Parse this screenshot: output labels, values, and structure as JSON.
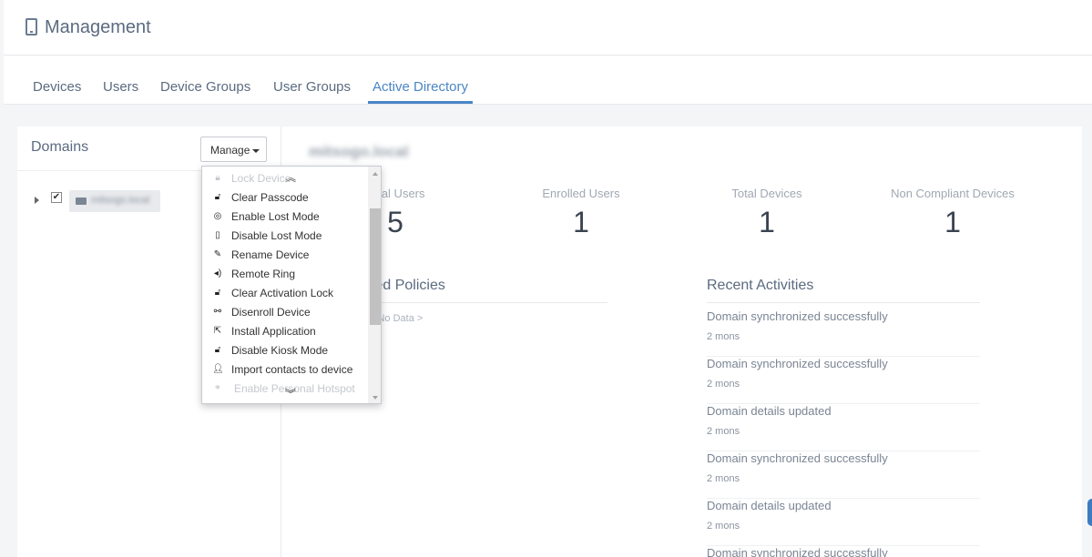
{
  "header": {
    "title": "Management",
    "icon": "mobile-phone-icon"
  },
  "tabs": [
    {
      "label": "Devices",
      "active": false
    },
    {
      "label": "Users",
      "active": false
    },
    {
      "label": "Device Groups",
      "active": false
    },
    {
      "label": "User Groups",
      "active": false
    },
    {
      "label": "Active Directory",
      "active": true
    }
  ],
  "sidebar": {
    "title": "Domains",
    "manage_label": "Manage",
    "tree": {
      "node_label": "mitsogo.local",
      "checked": true
    }
  },
  "domain": {
    "name": "mitsogo.local"
  },
  "stats": [
    {
      "label": "Total Users",
      "value": "5"
    },
    {
      "label": "Enrolled Users",
      "value": "1"
    },
    {
      "label": "Total Devices",
      "value": "1"
    },
    {
      "label": "Non Compliant Devices",
      "value": "1"
    }
  ],
  "policies": {
    "title": "Associated Policies",
    "empty_text": "< No Data >"
  },
  "activities": {
    "title": "Recent Activities",
    "items": [
      {
        "text": "Domain synchronized successfully",
        "time": "2 mons"
      },
      {
        "text": "Domain synchronized successfully",
        "time": "2 mons"
      },
      {
        "text": "Domain details updated",
        "time": "2 mons"
      },
      {
        "text": "Domain synchronized successfully",
        "time": "2 mons"
      },
      {
        "text": "Domain details updated",
        "time": "2 mons"
      },
      {
        "text": "Domain synchronized successfully",
        "time": ""
      }
    ]
  },
  "manage_menu": {
    "items": [
      {
        "label": "Lock Device",
        "icon": "lock-icon",
        "faded": true
      },
      {
        "label": "Clear Passcode",
        "icon": "unlock-icon",
        "faded": false
      },
      {
        "label": "Enable Lost Mode",
        "icon": "target-icon",
        "faded": false
      },
      {
        "label": "Disable Lost Mode",
        "icon": "mobile-icon",
        "faded": false
      },
      {
        "label": "Rename Device",
        "icon": "pencil-icon",
        "faded": false
      },
      {
        "label": "Remote Ring",
        "icon": "speaker-icon",
        "faded": false
      },
      {
        "label": "Clear Activation Lock",
        "icon": "unlock-icon",
        "faded": false
      },
      {
        "label": "Disenroll Device",
        "icon": "broken-link-icon",
        "faded": false
      },
      {
        "label": "Install Application",
        "icon": "share-icon",
        "faded": false
      },
      {
        "label": "Disable Kiosk Mode",
        "icon": "open-lock-icon",
        "faded": false
      },
      {
        "label": "Import contacts to device",
        "icon": "user-icon",
        "faded": false
      },
      {
        "label": "Enable Personal Hotspot",
        "icon": "link-icon",
        "faded": true
      }
    ]
  },
  "colors": {
    "accent": "#4a86c5",
    "text": "#5b6b80"
  }
}
